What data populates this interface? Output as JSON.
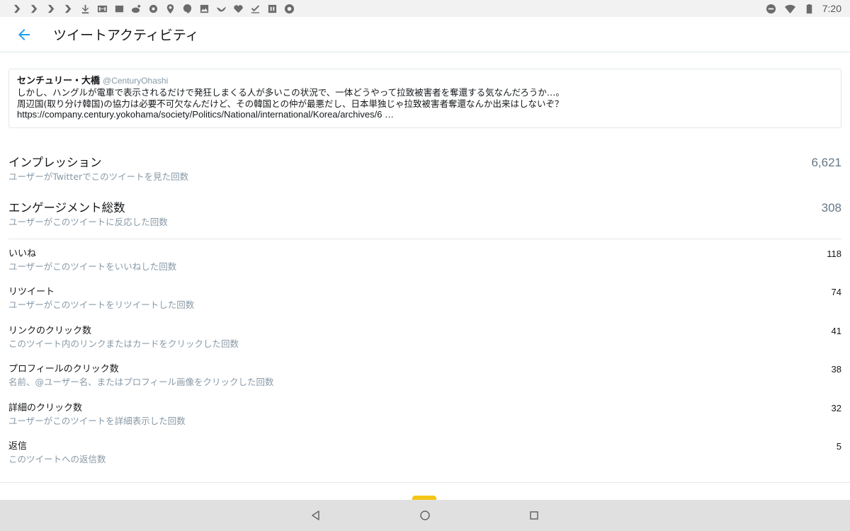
{
  "status_bar": {
    "time": "7:20",
    "left_icons": [
      "app-icon",
      "app-icon",
      "app-icon",
      "app-icon",
      "download-icon",
      "gmail-icon",
      "photo-icon",
      "weibo-icon",
      "app-icon",
      "maps-icon",
      "hangouts-icon",
      "image-icon",
      "bird-icon",
      "heart-icon",
      "check-icon",
      "app-icon",
      "chrome-icon"
    ],
    "right_icons": [
      "do-not-disturb-icon",
      "wifi-icon",
      "battery-icon"
    ]
  },
  "app_bar": {
    "title": "ツイートアクティビティ",
    "accent_color": "#1da1f2"
  },
  "tweet": {
    "author_name": "センチュリー・大橋",
    "author_handle": "@CenturyOhashi",
    "line1": "しかし、ハングルが電車で表示されるだけで発狂しまくる人が多いこの状況で、一体どうやって拉致被害者を奪還する気なんだろうか…。",
    "line2": "周辺国(取り分け韓国)の協力は必要不可欠なんだけど、その韓国との仲が最悪だし、日本単独じゃ拉致被害者奪還なんか出来はしないぞ？",
    "url": "https://company.century.yokohama/society/Politics/National/international/Korea/archives/6 …"
  },
  "summary_metrics": [
    {
      "label": "インプレッション",
      "description": "ユーザーがTwitterでこのツイートを見た回数",
      "value": "6,621"
    },
    {
      "label": "エンゲージメント総数",
      "description": "ユーザーがこのツイートに反応した回数",
      "value": "308"
    }
  ],
  "detail_metrics": [
    {
      "label": "いいね",
      "description": "ユーザーがこのツイートをいいねした回数",
      "value": "118"
    },
    {
      "label": "リツイート",
      "description": "ユーザーがこのツイートをリツイートした回数",
      "value": "74"
    },
    {
      "label": "リンクのクリック数",
      "description": "このツイート内のリンクまたはカードをクリックした回数",
      "value": "41"
    },
    {
      "label": "プロフィールのクリック数",
      "description": "名前、@ユーザー名、またはプロフィール画像をクリックした回数",
      "value": "38"
    },
    {
      "label": "詳細のクリック数",
      "description": "ユーザーがこのツイートを詳細表示した回数",
      "value": "32"
    },
    {
      "label": "返信",
      "description": "このツイートへの返信数",
      "value": "5"
    }
  ],
  "nav_bar": {
    "buttons": [
      "back-triangle-icon",
      "home-circle-icon",
      "recents-square-icon"
    ]
  }
}
